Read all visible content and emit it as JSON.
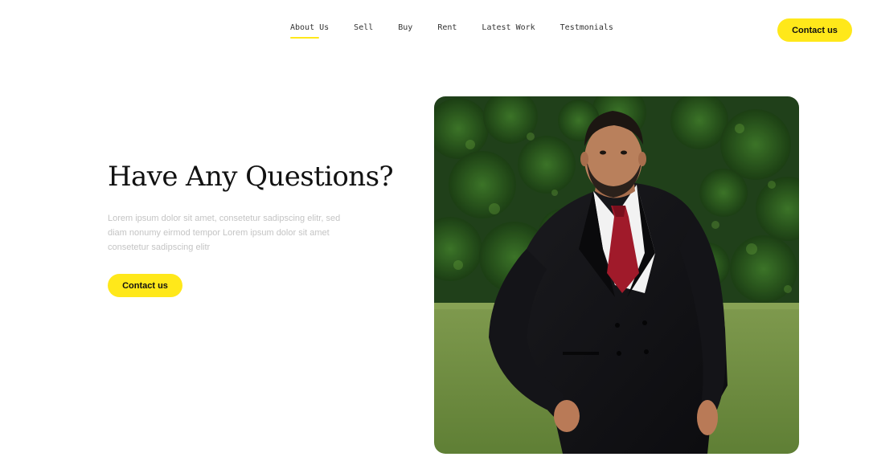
{
  "nav": {
    "items": [
      {
        "label": "About Us",
        "active": true
      },
      {
        "label": "Sell",
        "active": false
      },
      {
        "label": "Buy",
        "active": false
      },
      {
        "label": "Rent",
        "active": false
      },
      {
        "label": "Latest Work",
        "active": false
      },
      {
        "label": "Testmonials",
        "active": false
      }
    ],
    "cta_label": "Contact us"
  },
  "hero": {
    "title": "Have Any Questions?",
    "description": "Lorem ipsum dolor sit amet, consetetur sadipscing elitr, sed diam nonumy eirmod tempor Lorem ipsum dolor sit amet consetetur sadipscing elitr",
    "cta_label": "Contact us"
  },
  "photo": {
    "subject": "man in black double-breasted suit with red tie standing in front of green hedge on grass"
  },
  "colors": {
    "accent": "#FFE81A",
    "text": "#111111",
    "muted": "#C4C4C4"
  }
}
